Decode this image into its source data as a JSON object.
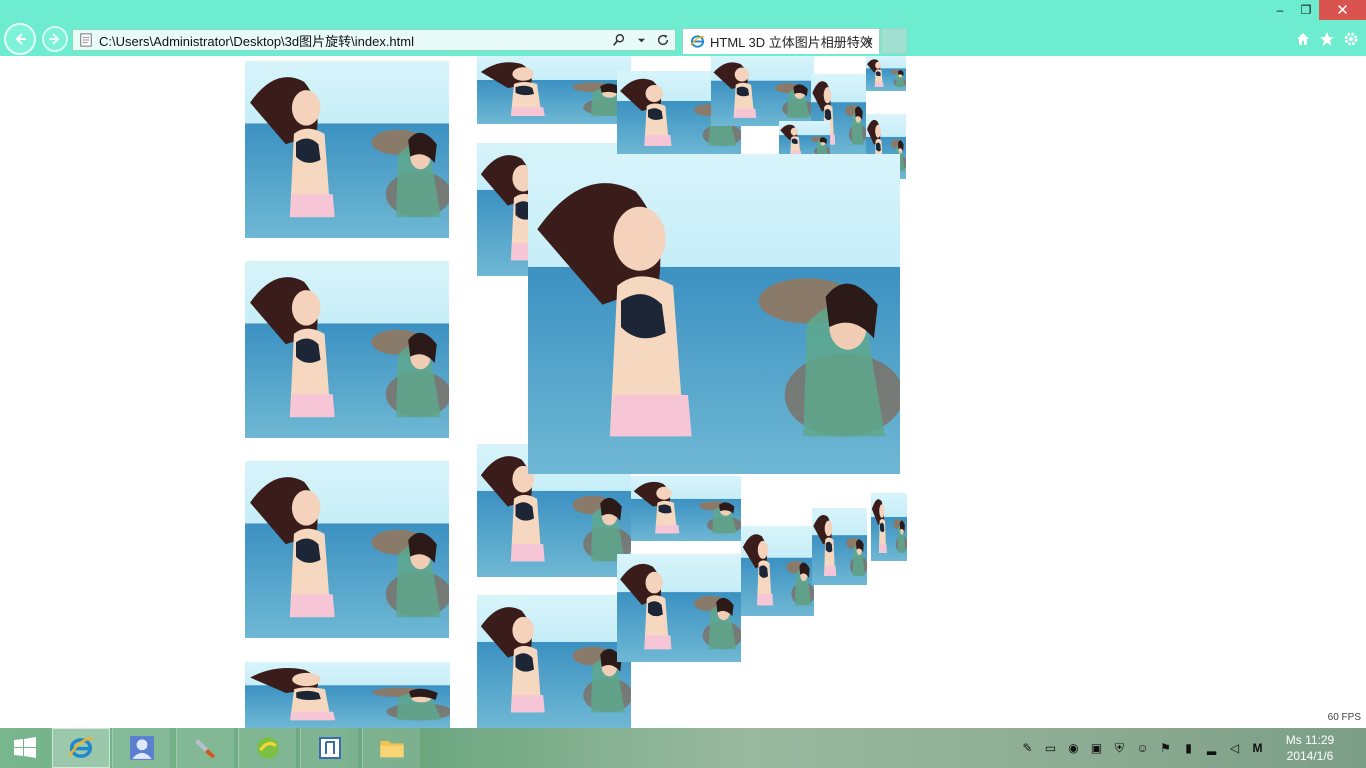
{
  "browser": {
    "url": "C:\\Users\\Administrator\\Desktop\\3d图片旋转\\index.html",
    "tab_title": "HTML 3D 立体图片相册特效",
    "tab_close": "✕",
    "window_controls": {
      "minimize": "‒",
      "restore": "❐",
      "close": "✕"
    },
    "icons": [
      "back-arrow-icon",
      "forward-arrow-icon",
      "ie-page-icon",
      "search-icon",
      "dropdown-icon",
      "refresh-icon",
      "home-icon",
      "star-icon",
      "gear-icon"
    ],
    "colors": {
      "chrome": "#6eecd0",
      "close": "#d9534f"
    }
  },
  "page": {
    "fps": "60 FPS",
    "photo_subject": "photo-thumbnail"
  },
  "taskbar": {
    "apps": [
      "internet-explorer",
      "user-app",
      "brush-app",
      "green-ball-app",
      "square-app",
      "file-explorer"
    ],
    "tray_label": "M",
    "clock_time": "Ms 11:29",
    "clock_date": "2014/1/6"
  }
}
